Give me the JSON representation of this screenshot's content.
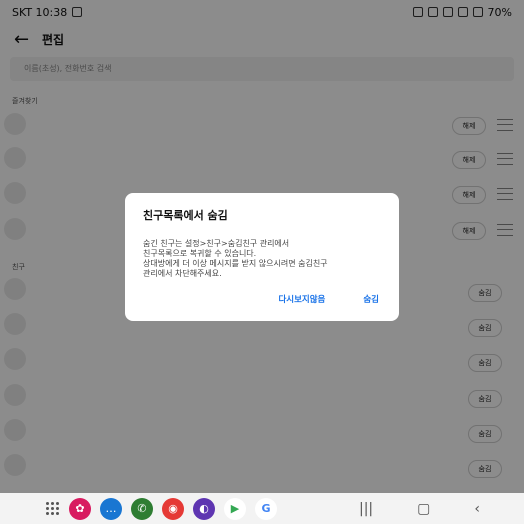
{
  "status": {
    "carrier_time": "SKT 10:38",
    "battery": "70%"
  },
  "header": {
    "title": "편집"
  },
  "search": {
    "placeholder": "이름(초성), 전화번호 검색"
  },
  "sections": {
    "favorites": "즐겨찾기",
    "friends": "친구"
  },
  "favorites": [
    {
      "button": "해제"
    },
    {
      "button": "해제"
    },
    {
      "button": "해제"
    },
    {
      "button": "해제"
    }
  ],
  "friends": [
    {
      "button": "숨김"
    },
    {
      "button": "숨김"
    },
    {
      "button": "숨김"
    },
    {
      "button": "숨김"
    },
    {
      "button": "숨김"
    },
    {
      "button": "숨김"
    }
  ],
  "dialog": {
    "title": "친구목록에서 숨김",
    "line1": "숨긴 친구는 설정>친구>숨김친구 관리에서",
    "line2": "친구목록으로 복귀할 수 있습니다.",
    "line3": "상대방에게 더 이상 메시지를 받지 않으시려면 숨김친구",
    "line4": "관리에서 차단해주세요.",
    "primary": "다시보지않음",
    "secondary": "숨김"
  },
  "navbar": {
    "apps": [
      "flower-app",
      "chat-app",
      "phone-app",
      "camera-app",
      "internet-app",
      "play-store",
      "google-app"
    ],
    "colors": {
      "accent": "#1a73e8"
    }
  }
}
